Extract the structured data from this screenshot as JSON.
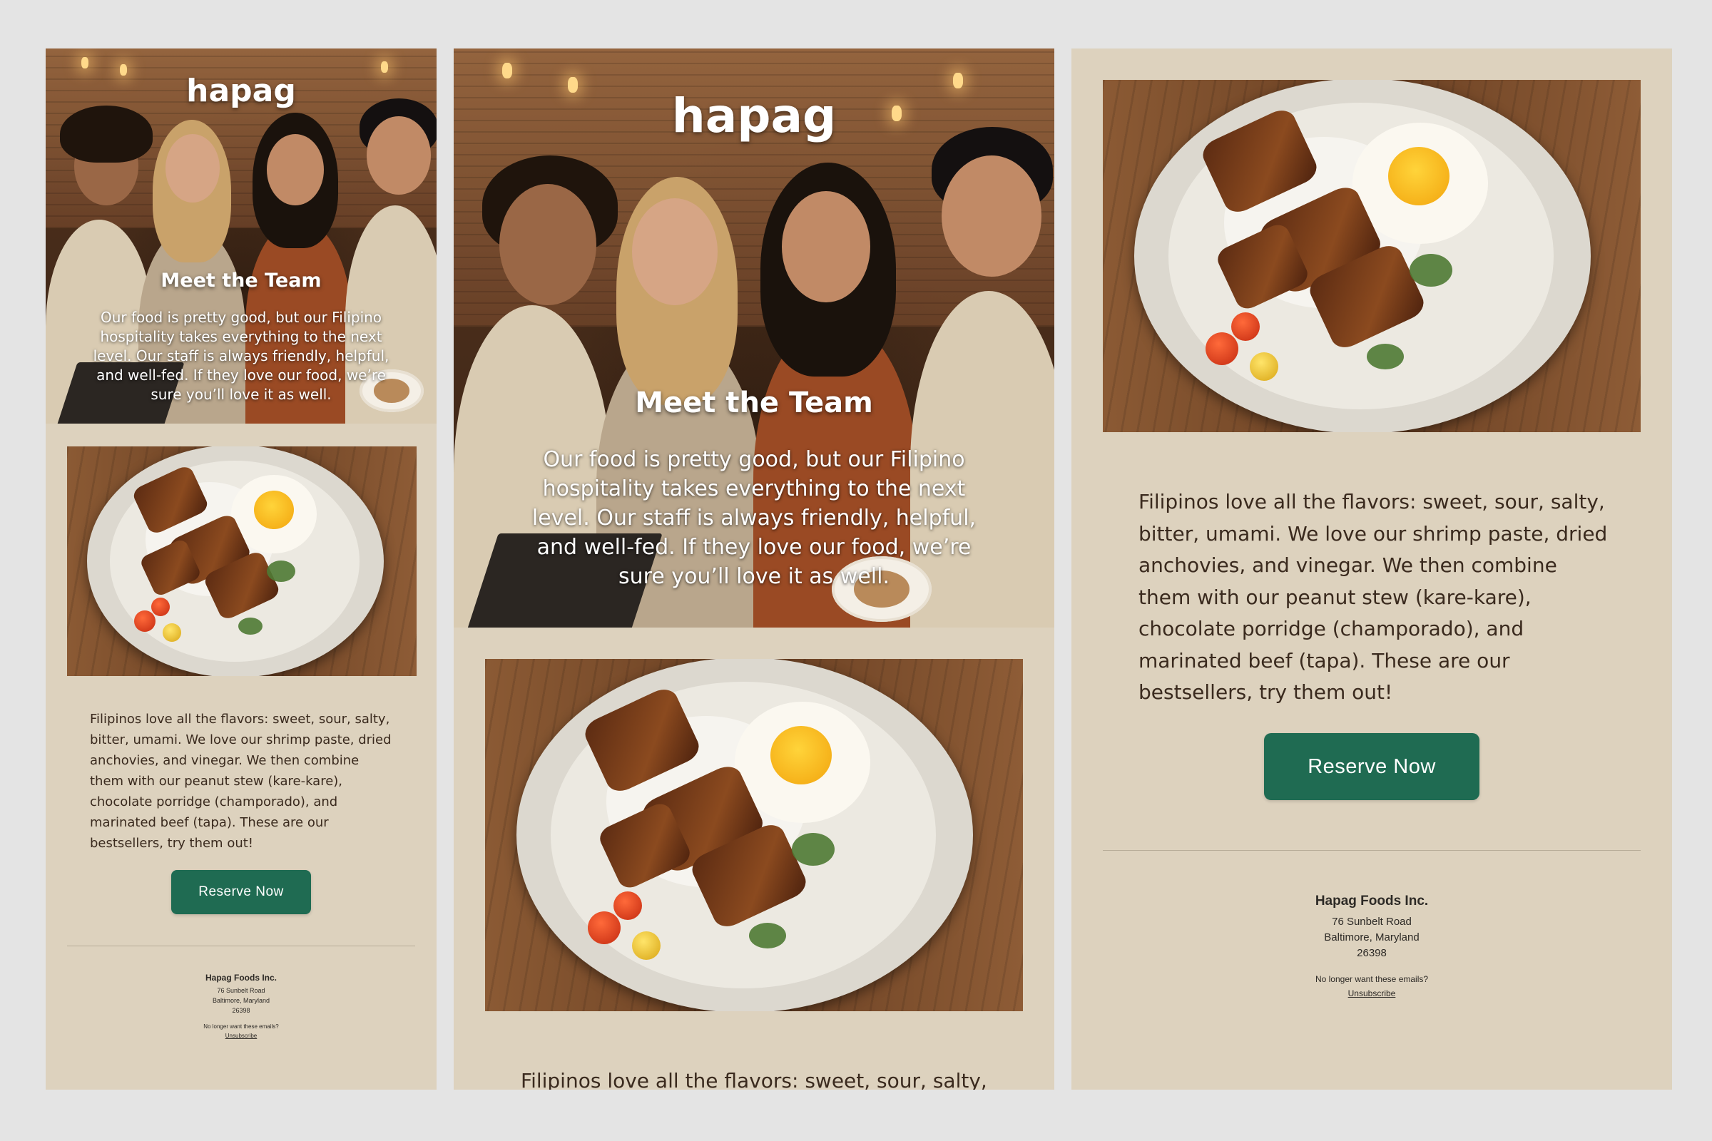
{
  "brand": {
    "logo": "hapag"
  },
  "hero": {
    "heading": "Meet the Team",
    "body": "Our food is pretty good, but our Filipino hospitality takes everything to the next level. Our staff is always friendly, helpful, and well-fed. If they love our food, we’re sure you’ll love it as well."
  },
  "content": {
    "body": "Filipinos love all the flavors: sweet, sour, salty, bitter, umami. We love our shrimp paste, dried anchovies, and vinegar. We then combine them with our peanut stew (kare-kare), chocolate porridge (champorado), and marinated beef (tapa). These are our bestsellers, try them out!",
    "body_partial": "Filipinos love all the flavors: sweet, sour, salty,"
  },
  "cta": {
    "label": "Reserve Now"
  },
  "footer": {
    "company": "Hapag Foods Inc.",
    "address_line1": "76 Sunbelt Road",
    "address_line2": "Baltimore, Maryland",
    "zip": "26398",
    "optout_text": "No longer want these emails?",
    "unsubscribe_label": "Unsubscribe"
  },
  "colors": {
    "page_bg": "#e4e4e4",
    "email_bg": "#ddd2be",
    "button": "#1f6b52",
    "text": "#3a2a1e"
  }
}
